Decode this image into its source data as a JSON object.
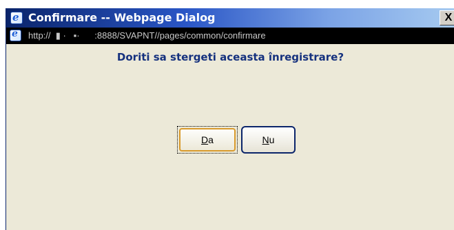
{
  "window": {
    "title": "Confirmare -- Webpage Dialog",
    "close_label": "X",
    "address": "http://  ▮ ·   ▪·      :8888/SVAPNT//pages/common/confirmare"
  },
  "dialog": {
    "message": "Doriti sa stergeti aceasta înregistrare?",
    "buttons": {
      "yes": {
        "mnemonic": "D",
        "rest": "a"
      },
      "no": {
        "mnemonic": "N",
        "rest": "u"
      }
    }
  },
  "colors": {
    "title_gradient_start": "#0a246a",
    "title_gradient_end": "#a6caf0",
    "message_text": "#15317e",
    "dialog_bg": "#ece9d8",
    "focus_border": "#d99a2b"
  },
  "icons": {
    "title": "ie-icon",
    "address": "ie-icon",
    "close": "close-icon"
  }
}
